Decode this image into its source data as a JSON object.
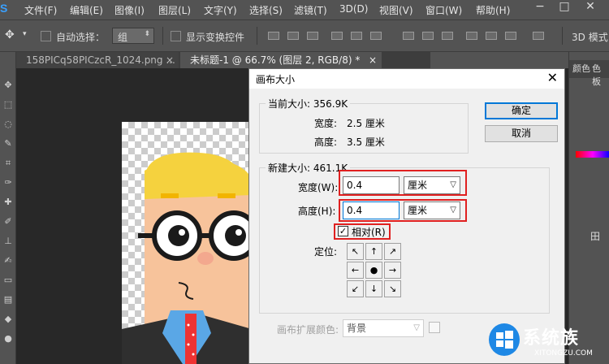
{
  "menubar": {
    "logo": "S",
    "items": [
      "文件(F)",
      "编辑(E)",
      "图像(I)",
      "图层(L)",
      "文字(Y)",
      "选择(S)",
      "滤镜(T)",
      "3D(D)",
      "视图(V)",
      "窗口(W)",
      "帮助(H)"
    ],
    "window_controls": [
      "−",
      "□",
      "✕"
    ]
  },
  "options": {
    "auto_select_label": "自动选择：",
    "auto_select_value": "组",
    "show_transform_label": "显示变换控件",
    "mode_label": "3D 模式："
  },
  "tabs": [
    {
      "label": "158PICq58PICzcR_1024.png ...",
      "close": "×"
    },
    {
      "label": "未标题-1 @ 66.7% (图层 2, RGB/8) *",
      "close": "×"
    }
  ],
  "right_panel": {
    "tab1": "颜色",
    "tab2": "色板",
    "partial_text": "田"
  },
  "dialog": {
    "title": "画布大小",
    "close": "✕",
    "current_size_label": "当前大小: 356.9K",
    "current_width_label": "宽度:",
    "current_width_value": "2.5 厘米",
    "current_height_label": "高度:",
    "current_height_value": "3.5 厘米",
    "new_size_label": "新建大小: 461.1K",
    "width_label": "宽度(W):",
    "width_value": "0.4",
    "width_unit": "厘米",
    "height_label": "高度(H):",
    "height_value": "0.4",
    "height_unit": "厘米",
    "relative_label": "相对(R)",
    "relative_checked": "✓",
    "anchor_label": "定位:",
    "anchor_arrows": [
      "↖",
      "↑",
      "↗",
      "←",
      "●",
      "→",
      "↙",
      "↓",
      "↘"
    ],
    "extend_color_label": "画布扩展颜色:",
    "extend_color_value": "背景",
    "ok_label": "确定",
    "cancel_label": "取消"
  },
  "watermark": {
    "text": "系统族",
    "url": "XITONGZU.COM"
  },
  "colors": {
    "highlight_red": "#e02020",
    "default_button": "#0078d7"
  }
}
